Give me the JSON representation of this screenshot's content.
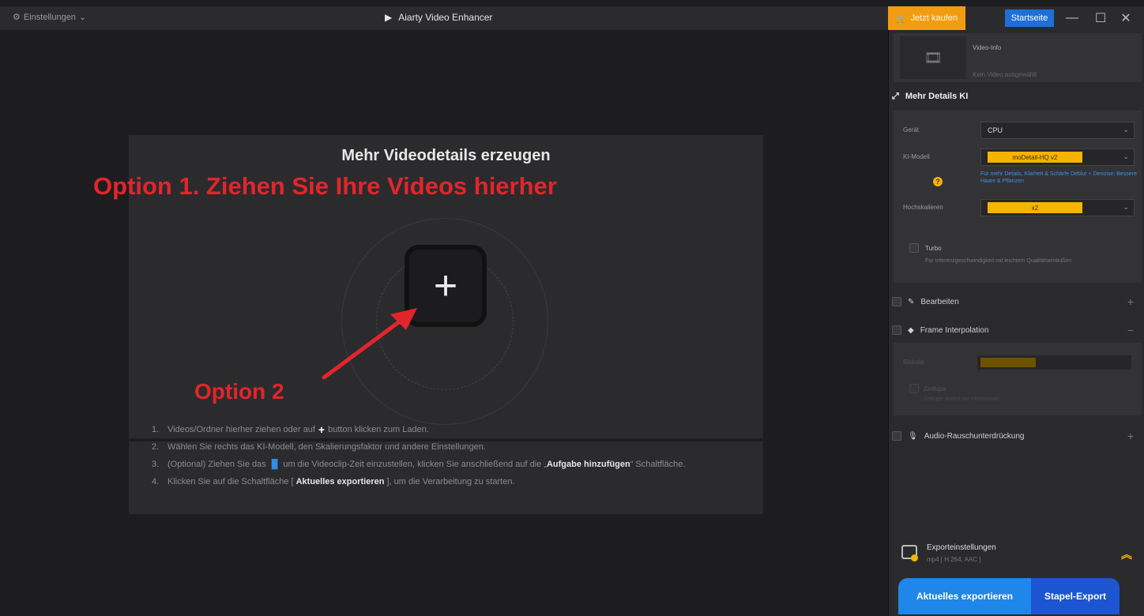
{
  "titlebar": {
    "settings_label": "Einstellungen",
    "app_title": "Aiarty Video Enhancer",
    "buy_label": "Jetzt kaufen",
    "home_label": "Startseite"
  },
  "main": {
    "dropzone_title": "Mehr Videodetails erzeugen",
    "option1": "Option 1. Ziehen Sie Ihre Videos hierher",
    "option2": "Option 2",
    "add_symbol": "+",
    "steps": [
      {
        "num": "1.",
        "pre": "Videos/Ordner hierher ziehen oder auf",
        "icon": "+",
        "post": "button klicken zum Laden."
      },
      {
        "num": "2.",
        "pre": "Wählen Sie rechts das KI-Modell, den Skalierungsfaktor und andere Einstellungen."
      },
      {
        "num": "3.",
        "pre": "(Optional) Ziehen Sie das",
        "post": "um die Videoclip-Zeit einzustellen, klicken Sie anschließend auf die „",
        "bold": "Aufgabe hinzufügen",
        "tail": "“ Schaltfläche."
      },
      {
        "num": "4.",
        "pre": "Klicken Sie auf die Schaltfläche [",
        "bold": "Aktuelles exportieren",
        "tail": "], um die Verarbeitung zu starten."
      }
    ]
  },
  "panel": {
    "video_info_title": "Video-Info",
    "video_info_sub": "Kein Video ausgewählt",
    "more_details": "Mehr Details KI",
    "device_label": "Gerät",
    "device_value": "CPU",
    "model_label": "KI-Modell",
    "model_value": "moDetail-HQ  v2",
    "model_desc": "Für mehr Details, Klarheit & Schärfe Deblur + Denoise: Bessere Haare & Pflanzen",
    "upscale_label": "Hochskalieren",
    "upscale_value": "x2",
    "turbo_label": "Turbo",
    "turbo_desc": "Für Inferenzgeschwindigkeit mit leichtem Qualitätseinbußen",
    "edit_label": "Bearbeiten",
    "frame_label": "Frame Interpolation",
    "fi_rate_label": "Bildrate",
    "fi_slomo_label": "Zeitlupe",
    "fi_slomo_desc": "Zeitlupe ändert die Videodauer",
    "audio_label": "Audio-Rauschunterdrückung",
    "export_title": "Exporteinstellungen",
    "export_sub": "mp4 [ H.264, AAC ]",
    "btn_export": "Aktuelles exportieren",
    "btn_batch": "Stapel-Export"
  },
  "colors": {
    "accent_orange": "#f39c12",
    "accent_blue": "#1f6fd6",
    "annotation_red": "#e3242b",
    "highlight_yellow": "#f6b400"
  }
}
